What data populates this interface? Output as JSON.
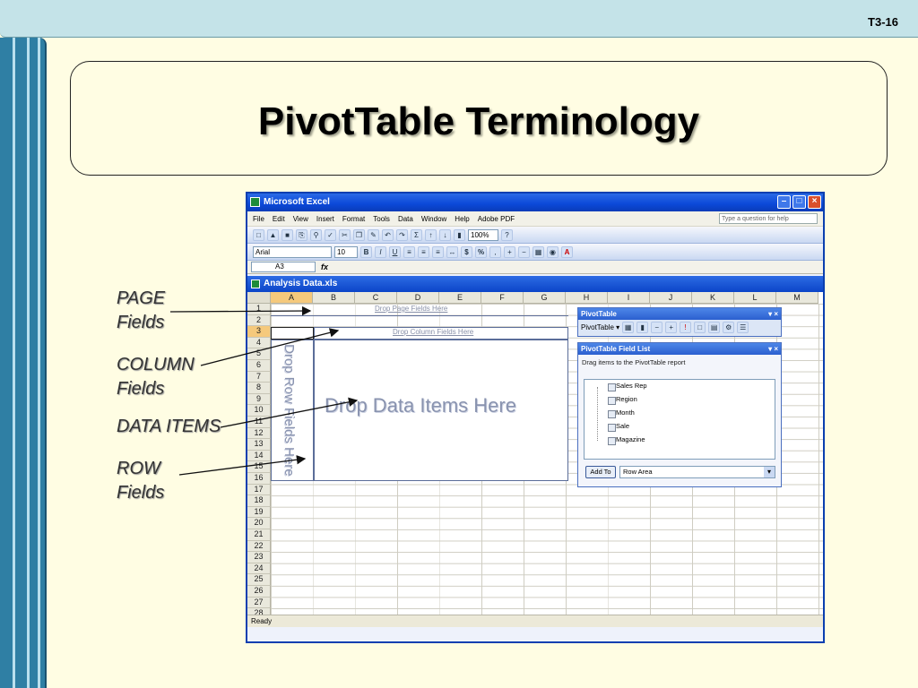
{
  "slide": {
    "number": "T3-16",
    "title": "PivotTable Terminology",
    "labels": {
      "page": [
        "PAGE",
        "Fields"
      ],
      "column": [
        "COLUMN",
        "Fields"
      ],
      "data": [
        "DATA ITEMS"
      ],
      "row": [
        "ROW",
        "Fields"
      ]
    }
  },
  "excel": {
    "app_title": "Microsoft Excel",
    "menu": [
      "File",
      "Edit",
      "View",
      "Insert",
      "Format",
      "Tools",
      "Data",
      "Window",
      "Help",
      "Adobe PDF"
    ],
    "help_placeholder": "Type a question for help",
    "zoom": "100%",
    "font": "Arial",
    "font_size": "10",
    "name_box": "A3",
    "fx": "fx",
    "workbook_title": "Analysis Data.xls",
    "columns": [
      "A",
      "B",
      "C",
      "D",
      "E",
      "F",
      "G",
      "H",
      "I",
      "J",
      "K",
      "L",
      "M"
    ],
    "rows": [
      "1",
      "2",
      "3",
      "4",
      "5",
      "6",
      "7",
      "8",
      "9",
      "10",
      "11",
      "12",
      "13",
      "14",
      "15",
      "16",
      "17",
      "18",
      "19",
      "20",
      "21",
      "22",
      "23",
      "24",
      "25",
      "26",
      "27",
      "28"
    ],
    "drop_page": "Drop Page Fields Here",
    "drop_column": "Drop Column Fields Here",
    "drop_data": "Drop Data Items Here",
    "drop_row": "Drop Row Fields Here",
    "status": "Ready"
  },
  "pivot_toolbar": {
    "title": "PivotTable",
    "menu_label": "PivotTable ▾"
  },
  "field_list": {
    "title": "PivotTable Field List",
    "subtitle": "Drag items to the PivotTable report",
    "fields": [
      "Sales Rep",
      "Region",
      "Month",
      "Sale",
      "Magazine"
    ],
    "add_to": "Add To",
    "area": "Row Area"
  }
}
